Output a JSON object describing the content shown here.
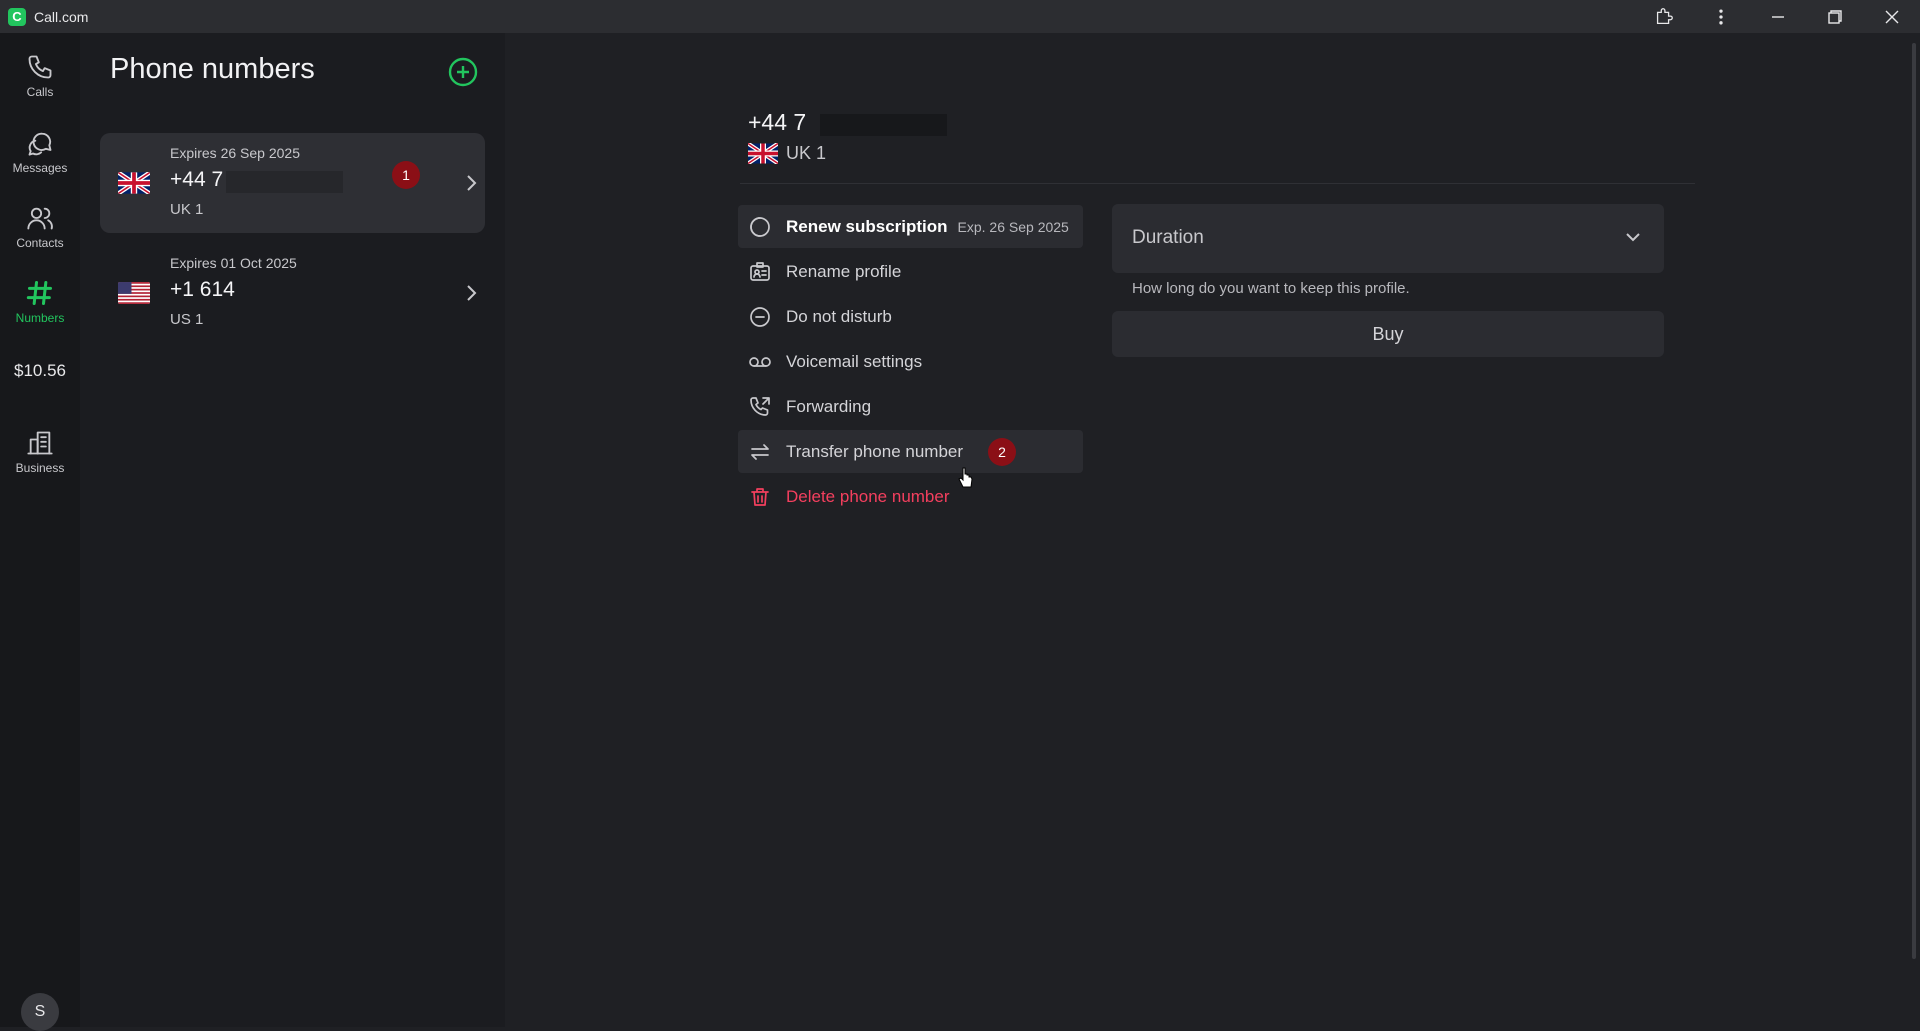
{
  "window": {
    "title": "Call.com",
    "logo_letter": "C"
  },
  "rail": {
    "items": [
      {
        "label": "Calls",
        "icon": "phone-icon"
      },
      {
        "label": "Messages",
        "icon": "chat-bubbles-icon"
      },
      {
        "label": "Contacts",
        "icon": "users-icon"
      },
      {
        "label": "Numbers",
        "icon": "hash-icon",
        "active": true
      },
      {
        "label": "Business",
        "icon": "building-icon"
      }
    ],
    "balance": "$10.56",
    "avatar_initial": "S"
  },
  "list": {
    "title": "Phone numbers",
    "numbers": [
      {
        "expiry": "Expires 26 Sep 2025",
        "number": "+44 7",
        "label": "UK 1",
        "flag": "uk-flag-icon",
        "badge": "1",
        "selected": true
      },
      {
        "expiry": "Expires 01 Oct 2025",
        "number": "+1 614",
        "label": "US 1",
        "flag": "us-flag-icon",
        "selected": false
      }
    ]
  },
  "detail": {
    "number": "+44 7",
    "label": "UK 1",
    "menu": [
      {
        "label": "Renew subscription",
        "extra": "Exp. 26 Sep 2025",
        "icon": "renew-icon"
      },
      {
        "label": "Rename profile",
        "icon": "id-card-icon"
      },
      {
        "label": "Do not disturb",
        "icon": "minus-circle-icon"
      },
      {
        "label": "Voicemail settings",
        "icon": "voicemail-icon"
      },
      {
        "label": "Forwarding",
        "icon": "phone-forward-icon"
      },
      {
        "label": "Transfer phone number",
        "icon": "transfer-arrows-icon",
        "badge": "2"
      },
      {
        "label": "Delete phone number",
        "icon": "trash-icon"
      }
    ],
    "duration": {
      "label": "Duration",
      "help": "How long do you want to keep this profile."
    },
    "buy_label": "Buy"
  },
  "colors": {
    "accent": "#22c55e",
    "danger": "#f43f5e",
    "badge": "#8b0f16",
    "background": "#1f2024"
  }
}
